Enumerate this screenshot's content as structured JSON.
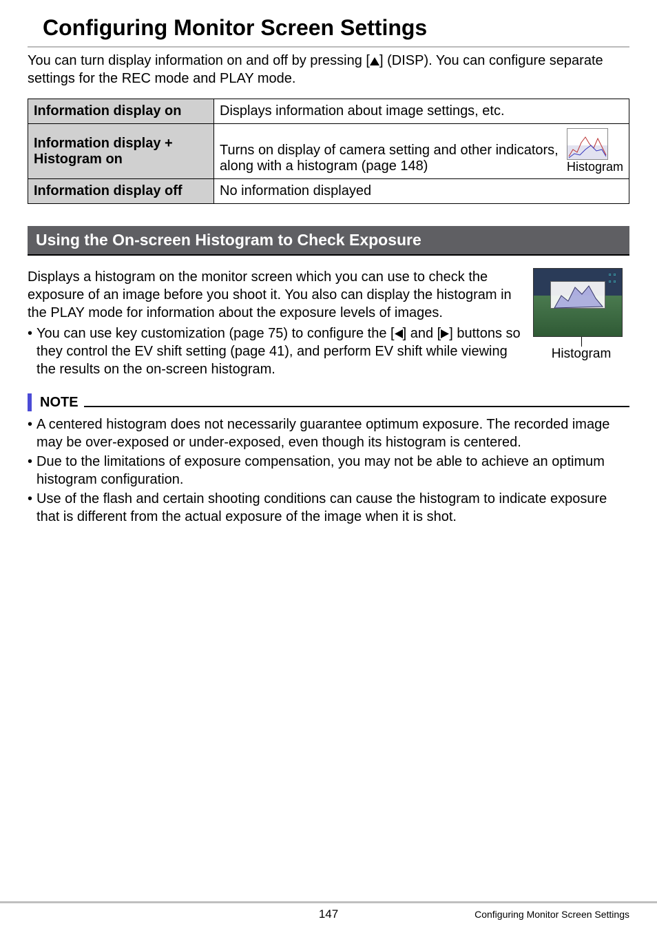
{
  "title": "Configuring Monitor Screen Settings",
  "intro_a": "You can turn display information on and off by pressing [",
  "intro_b": "] (DISP). You can configure separate settings for the REC mode and PLAY mode.",
  "table": {
    "r1h": "Information display on",
    "r1d": "Displays information about image settings, etc.",
    "r2h": "Information display + Histogram on",
    "r2d": "Turns on display of camera setting and other indicators, along with a histogram (page 148)",
    "r2img": "Histogram",
    "r3h": "Information display off",
    "r3d": "No information displayed"
  },
  "section_title": "Using the On-screen Histogram to Check Exposure",
  "section_p": "Displays a histogram on the monitor screen which you can use to check the exposure of an image before you shoot it. You also can display the histogram in the PLAY mode for information about the exposure levels of images.",
  "section_bullet_a": "You can use key customization (page 75) to configure the [",
  "section_bullet_b": "] and [",
  "section_bullet_c": "] buttons so they control the EV shift setting (page 41), and perform EV shift while viewing the results on the on-screen histogram.",
  "section_img_label": "Histogram",
  "note_label": "NOTE",
  "notes": [
    "A centered histogram does not necessarily guarantee optimum exposure. The recorded image may be over-exposed or under-exposed, even though its histogram is centered.",
    "Due to the limitations of exposure compensation, you may not be able to achieve an optimum histogram configuration.",
    "Use of the flash and certain shooting conditions can cause the histogram to indicate exposure that is different from the actual exposure of the image when it is shot."
  ],
  "footer": {
    "page": "147",
    "section": "Configuring Monitor Screen Settings"
  }
}
